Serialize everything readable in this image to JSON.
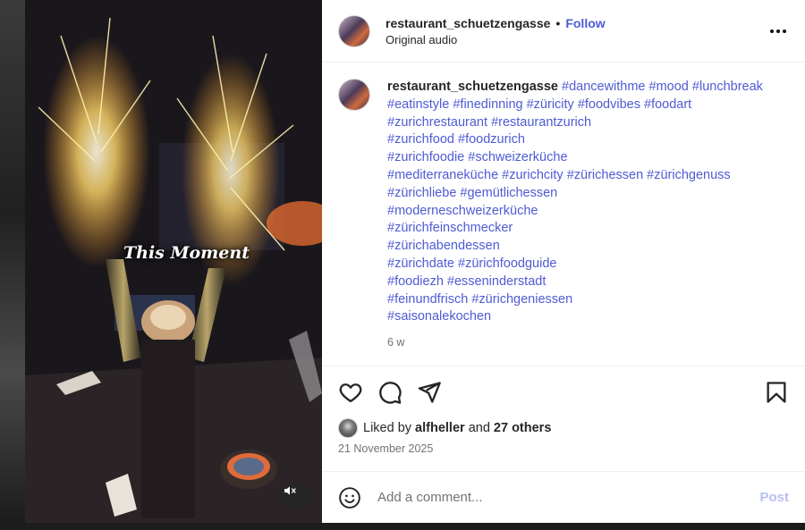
{
  "post": {
    "username": "restaurant_schuetzengasse",
    "follow_label": "Follow",
    "audio": "Original audio",
    "media_overlay_text": "This Moment",
    "caption_hashtags": [
      "#dancewithme",
      "#mood",
      "#lunchbreak",
      "#eatinstyle",
      "#finedinning",
      "#züricity",
      "#foodvibes",
      "#foodart",
      "#zurichrestaurant",
      "#restaurantzurich",
      "#zurichfood",
      "#foodzurich",
      "#zurichfoodie",
      "#schweizerküche",
      "#mediterraneküche",
      "#zurichcity",
      "#zürichessen",
      "#zürichgenuss",
      "#zürichliebe",
      "#gemütlichessen",
      "#moderneschweizerküche",
      "#zürichfeinschmecker",
      "#zürichabendessen",
      "#zürichdate",
      "#zürichfoodguide",
      "#foodiezh",
      "#esseninderstadt",
      "#feinundfrisch",
      "#zürichgeniessen",
      "#saisonalekochen"
    ],
    "caption_lines": [
      [
        0,
        1,
        2
      ],
      [
        3,
        4,
        5,
        6,
        7
      ],
      [
        8,
        9
      ],
      [
        10,
        11
      ],
      [
        12,
        13
      ],
      [
        14,
        15,
        16,
        17
      ],
      [
        18,
        19
      ],
      [
        20
      ],
      [
        21
      ],
      [
        22
      ],
      [
        23,
        24
      ],
      [
        25,
        26
      ],
      [
        27,
        28
      ],
      [
        29
      ]
    ],
    "time_ago": "6 w",
    "liked_by_prefix": "Liked by",
    "liked_by_user": "alfheller",
    "liked_by_and": "and",
    "liked_by_others": "27 others",
    "date": "21 November 2025",
    "comment_placeholder": "Add a comment...",
    "post_label": "Post"
  },
  "icons": {
    "more": "more-options-icon",
    "like": "heart-icon",
    "comment": "comment-icon",
    "share": "share-icon",
    "save": "bookmark-icon",
    "emoji": "emoji-icon",
    "mute": "muted-speaker-icon"
  },
  "colors": {
    "link": "#4e5bd4",
    "text": "#262626",
    "muted": "#737373",
    "post_disabled": "#b8bff2"
  }
}
